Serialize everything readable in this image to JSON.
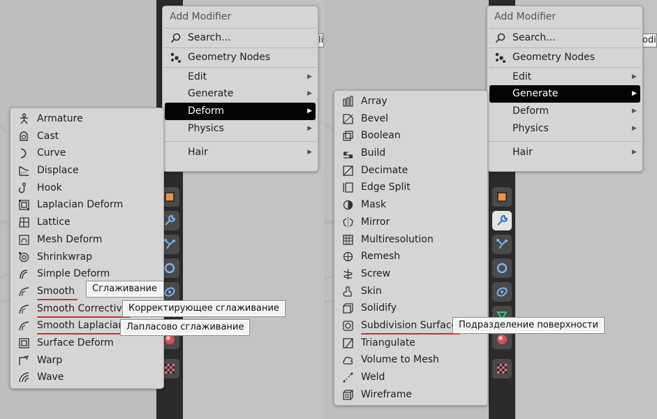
{
  "left": {
    "menu": {
      "title": "Add Modifier",
      "search": "Search...",
      "geometry_nodes": "Geometry Nodes",
      "items": [
        {
          "label": "Edit",
          "highlighted": false
        },
        {
          "label": "Generate",
          "highlighted": false
        },
        {
          "label": "Deform",
          "highlighted": true
        },
        {
          "label": "Physics",
          "highlighted": false
        }
      ],
      "hair": "Hair"
    },
    "peek_text": "lif",
    "submenu_name": "Deform",
    "list": [
      {
        "label": "Armature",
        "icon": "armature-icon"
      },
      {
        "label": "Cast",
        "icon": "cast-icon"
      },
      {
        "label": "Curve",
        "icon": "curve-icon"
      },
      {
        "label": "Displace",
        "icon": "displace-icon"
      },
      {
        "label": "Hook",
        "icon": "hook-icon"
      },
      {
        "label": "Laplacian Deform",
        "icon": "laplacian-deform-icon"
      },
      {
        "label": "Lattice",
        "icon": "lattice-icon"
      },
      {
        "label": "Mesh Deform",
        "icon": "mesh-deform-icon"
      },
      {
        "label": "Shrinkwrap",
        "icon": "shrinkwrap-icon"
      },
      {
        "label": "Simple Deform",
        "icon": "simple-deform-icon"
      },
      {
        "label": "Smooth",
        "icon": "smooth-icon",
        "underlined": true
      },
      {
        "label": "Smooth Corrective",
        "icon": "smooth-corrective-icon",
        "underlined": true
      },
      {
        "label": "Smooth Laplacian",
        "icon": "smooth-laplacian-icon",
        "underlined": true
      },
      {
        "label": "Surface Deform",
        "icon": "surface-deform-icon"
      },
      {
        "label": "Warp",
        "icon": "warp-icon"
      },
      {
        "label": "Wave",
        "icon": "wave-icon"
      }
    ],
    "translations": [
      {
        "for": "Smooth",
        "text": "Сглаживание"
      },
      {
        "for": "Smooth Corrective",
        "text": "Корректирующее сглаживание"
      },
      {
        "for": "Smooth Laplacian",
        "text": "Лапласово сглаживание"
      }
    ]
  },
  "right": {
    "menu": {
      "title": "Add Modifier",
      "search": "Search...",
      "geometry_nodes": "Geometry Nodes",
      "items": [
        {
          "label": "Edit",
          "highlighted": false
        },
        {
          "label": "Generate",
          "highlighted": true
        },
        {
          "label": "Deform",
          "highlighted": false
        },
        {
          "label": "Physics",
          "highlighted": false
        }
      ],
      "hair": "Hair"
    },
    "peek_text": "odif",
    "submenu_name": "Generate",
    "list": [
      {
        "label": "Array",
        "icon": "array-icon"
      },
      {
        "label": "Bevel",
        "icon": "bevel-icon"
      },
      {
        "label": "Boolean",
        "icon": "boolean-icon"
      },
      {
        "label": "Build",
        "icon": "build-icon"
      },
      {
        "label": "Decimate",
        "icon": "decimate-icon"
      },
      {
        "label": "Edge Split",
        "icon": "edge-split-icon"
      },
      {
        "label": "Mask",
        "icon": "mask-icon"
      },
      {
        "label": "Mirror",
        "icon": "mirror-icon"
      },
      {
        "label": "Multiresolution",
        "icon": "multiresolution-icon"
      },
      {
        "label": "Remesh",
        "icon": "remesh-icon"
      },
      {
        "label": "Screw",
        "icon": "screw-icon"
      },
      {
        "label": "Skin",
        "icon": "skin-icon"
      },
      {
        "label": "Solidify",
        "icon": "solidify-icon"
      },
      {
        "label": "Subdivision Surface",
        "icon": "subdivision-surface-icon",
        "underlined": true
      },
      {
        "label": "Triangulate",
        "icon": "triangulate-icon"
      },
      {
        "label": "Volume to Mesh",
        "icon": "volume-to-mesh-icon"
      },
      {
        "label": "Weld",
        "icon": "weld-icon"
      },
      {
        "label": "Wireframe",
        "icon": "wireframe-icon"
      }
    ],
    "translations": [
      {
        "for": "Subdivision Surface",
        "text": "Подразделение поверхности"
      }
    ]
  },
  "colors": {
    "highlight_bg": "#050505",
    "underline": "#d22b2b",
    "menu_bg": "#d5d5d5"
  }
}
